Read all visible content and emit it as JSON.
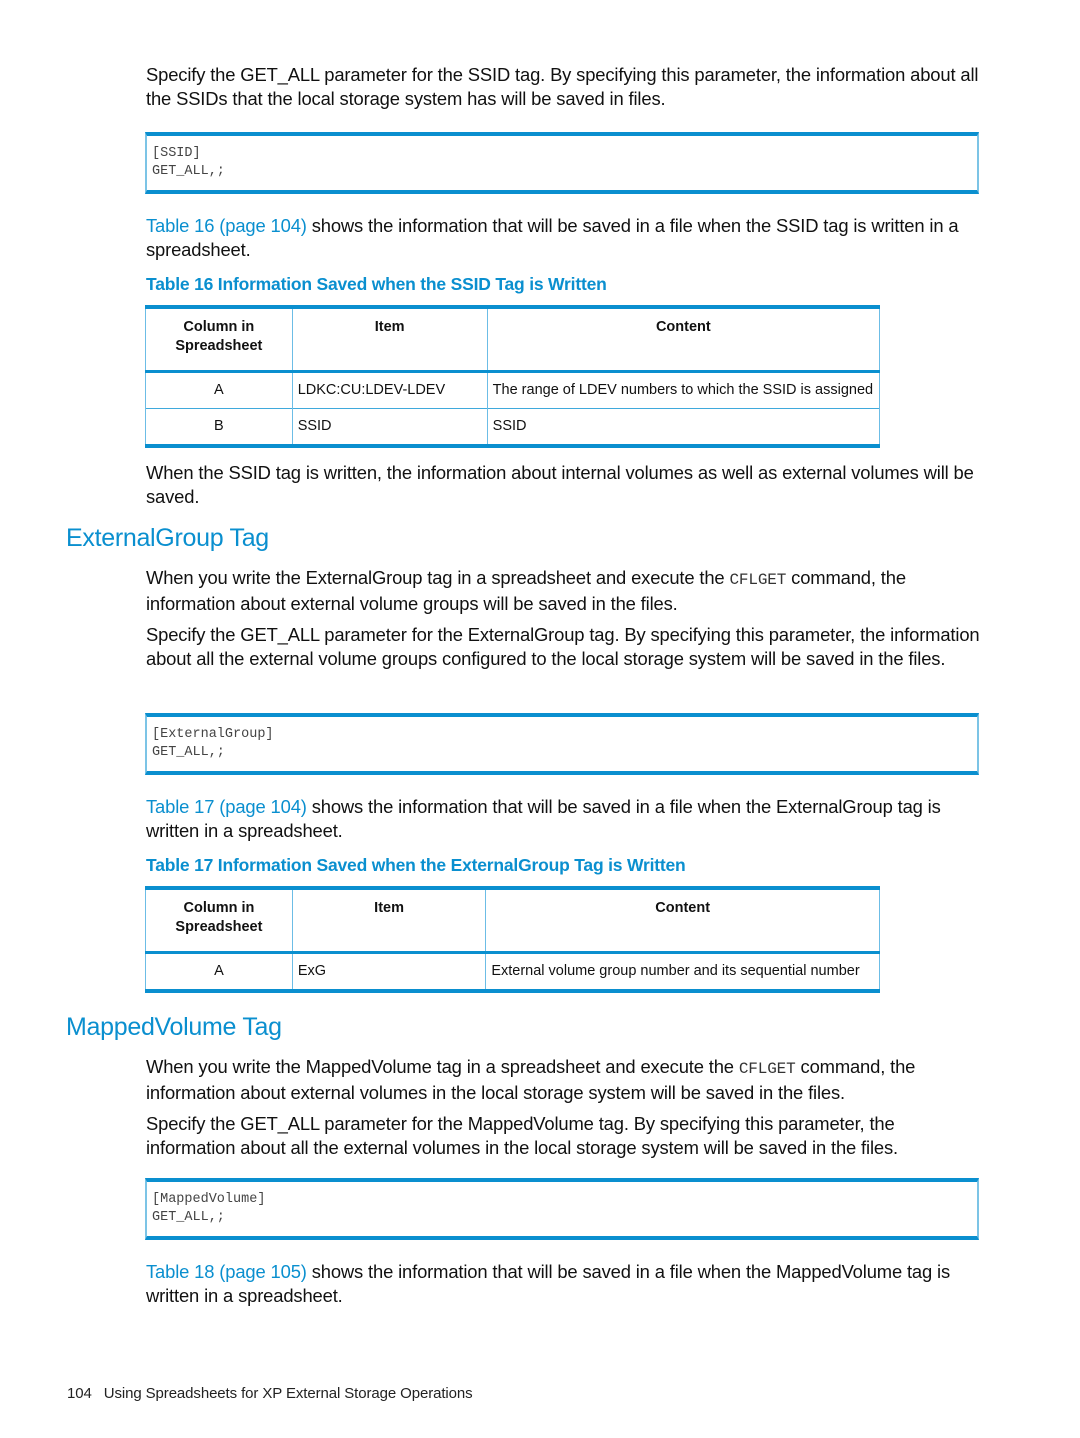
{
  "page": {
    "intro_paragraph": "Specify the GET_ALL parameter for the SSID tag. By specifying this parameter, the information about all the SSIDs that the local storage system has will be saved in files.",
    "ssid_code": {
      "line1": "[SSID]",
      "line2": "GET_ALL,;"
    },
    "table16_ref": {
      "link": "Table 16 (page 104)",
      "text": " shows the information that will be saved in a file when the SSID tag is written in a spreadsheet."
    },
    "table16": {
      "caption": "Table 16 Information Saved when the SSID Tag is Written",
      "headers": [
        "Column in Spreadsheet",
        "Item",
        "Content"
      ],
      "rows": [
        {
          "column": "A",
          "item": "LDKC:CU:LDEV-LDEV",
          "content": "The range of LDEV numbers to which the SSID is assigned"
        },
        {
          "column": "B",
          "item": "SSID",
          "content": "SSID"
        }
      ]
    },
    "ssid_note": "When the SSID tag is written, the information about internal volumes as well as external volumes will be saved.",
    "external_group": {
      "heading": "ExternalGroup Tag",
      "para1_before": "When you write the ExternalGroup tag in a spreadsheet and execute the ",
      "para1_code": "CFLGET",
      "para1_after": " command, the information about external volume groups will be saved in the files.",
      "para2": "Specify the GET_ALL parameter for the ExternalGroup tag. By specifying this parameter, the information about all the external volume groups configured to the local storage system will be saved in the files.",
      "code": {
        "line1": "[ExternalGroup]",
        "line2": "GET_ALL,;"
      },
      "table_ref": {
        "link": "Table 17 (page 104)",
        "text": " shows the information that will be saved in a file when the ExternalGroup tag is written in a spreadsheet."
      }
    },
    "table17": {
      "caption": "Table 17 Information Saved when the ExternalGroup Tag is Written",
      "headers": [
        "Column in Spreadsheet",
        "Item",
        "Content"
      ],
      "rows": [
        {
          "column": "A",
          "item": "ExG",
          "content": "External volume group number and its sequential number"
        }
      ]
    },
    "mapped_volume": {
      "heading": "MappedVolume Tag",
      "para1_before": "When you write the MappedVolume tag in a spreadsheet and execute the ",
      "para1_code": "CFLGET",
      "para1_after": " command, the information about external volumes in the local storage system will be saved in the files.",
      "para2": "Specify the GET_ALL parameter for the MappedVolume tag. By specifying this parameter, the information about all the external volumes in the local storage system will be saved in the files.",
      "code": {
        "line1": "[MappedVolume]",
        "line2": "GET_ALL,;"
      },
      "table_ref": {
        "link": "Table 18 (page 105)",
        "text": " shows the information that will be saved in a file when the MappedVolume tag is written in a spreadsheet."
      }
    },
    "footer": {
      "page_number": "104",
      "title": "Using Spreadsheets for XP External Storage Operations"
    },
    "colors": {
      "accent": "#0a8fcf",
      "border_light": "#6cbde6",
      "text": "#111111"
    }
  }
}
